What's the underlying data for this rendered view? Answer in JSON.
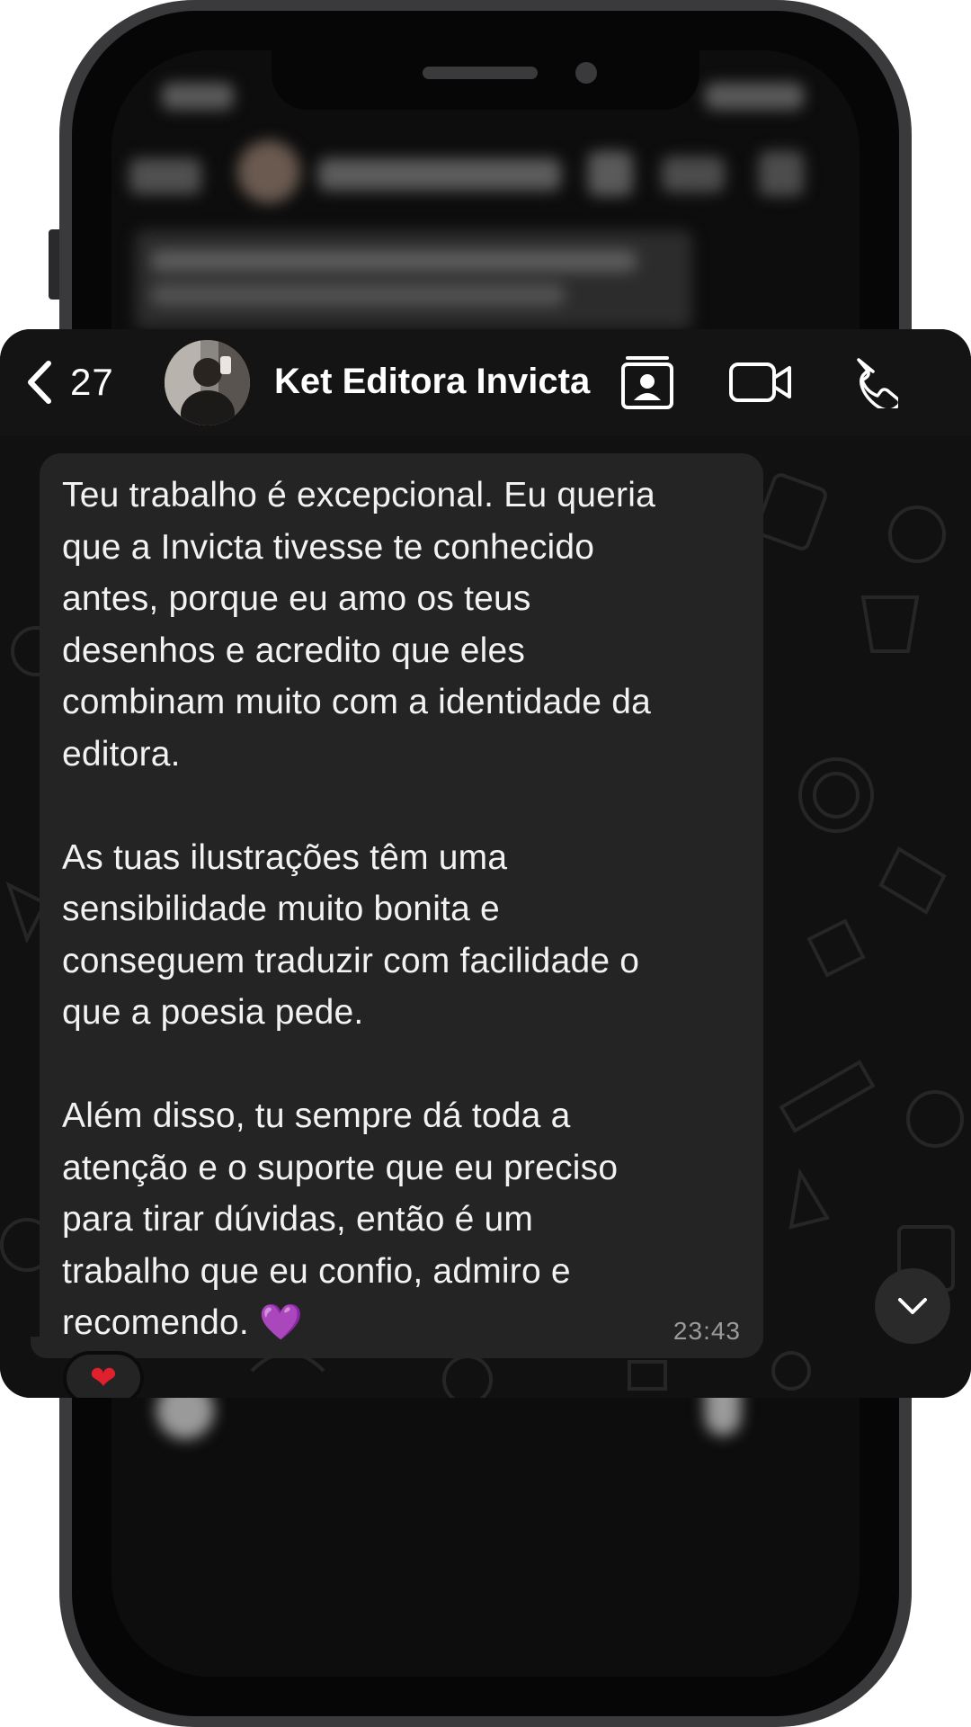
{
  "header": {
    "back_count": "27",
    "contact_name": "Ket Editora Invicta"
  },
  "message": {
    "text": "Teu trabalho é excepcional. Eu queria\nque a Invicta tivesse te conhecido\nantes, porque eu amo os teus\ndesenhos e acredito que eles\ncombinam muito com a identidade da\neditora.\n\nAs tuas ilustrações têm uma\nsensibilidade muito bonita e\nconseguem traduzir com facilidade o\nque a poesia pede.\n\nAlém disso, tu sempre dá toda a\natenção e o suporte que eu preciso\npara tirar dúvidas, então é um\ntrabalho que eu confio, admiro e\nrecomendo. 💜",
    "time": "23:43",
    "reaction": "❤"
  },
  "icons": {
    "back": "chevron-left-icon",
    "contact_card": "contact-card-icon",
    "video": "video-camera-icon",
    "phone": "phone-icon",
    "scroll": "chevron-down-icon"
  },
  "colors": {
    "bubble": "#242424",
    "header": "#141414",
    "background": "#111111",
    "reaction": "#e0202d"
  }
}
